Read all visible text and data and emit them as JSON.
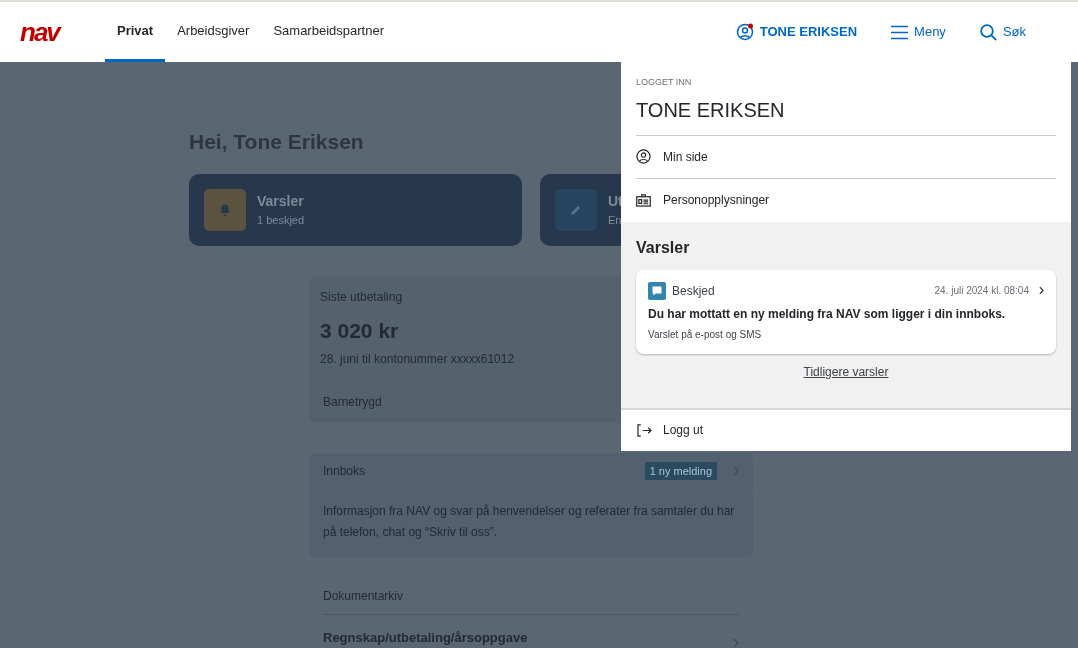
{
  "header": {
    "logo": "nav",
    "tabs": [
      {
        "label": "Privat",
        "selected": true
      },
      {
        "label": "Arbeidsgiver",
        "selected": false
      },
      {
        "label": "Samarbeidspartner",
        "selected": false
      }
    ],
    "user": {
      "label": "TONE ERIKSEN",
      "unread": true
    },
    "menu": "Meny",
    "search": "Søk"
  },
  "page": {
    "greeting": "Hei, Tone Eriksen",
    "cards": [
      {
        "kind": "bell",
        "title": "Varsler",
        "subtitle": "1 beskjed"
      },
      {
        "kind": "pencil",
        "title": "Ut",
        "subtitle": "En"
      }
    ],
    "payment": {
      "label": "Siste utbetaling",
      "amount": "3 020 kr",
      "detail": "28. juni til kontonummer xxxxx61012",
      "type": "Barnetrygd"
    },
    "inbox": {
      "title": "Innboks",
      "badge": "1 ny melding",
      "text": "Informasjon fra NAV og svar på henvendelser og referater fra samtaler du har på telefon, chat og “Skriv til oss”."
    },
    "archive": {
      "title": "Dokumentarkiv",
      "item": "Regnskap/utbetaling/årsoppgave"
    }
  },
  "dropdown": {
    "caption": "LOGGET INN",
    "name": "TONE ERIKSEN",
    "links": [
      {
        "kind": "person",
        "label": "Min side"
      },
      {
        "kind": "idcard",
        "label": "Personopplysninger"
      }
    ],
    "notifications": {
      "title": "Varsler",
      "items": [
        {
          "type": "Beskjed",
          "date": "24. juli 2024 kl. 08:04",
          "message": "Du har mottatt en ny melding fra NAV som ligger i din innboks.",
          "channel": "Varslet på e-post og SMS"
        }
      ],
      "more": "Tidligere varsler"
    },
    "logout": "Logg ut"
  }
}
